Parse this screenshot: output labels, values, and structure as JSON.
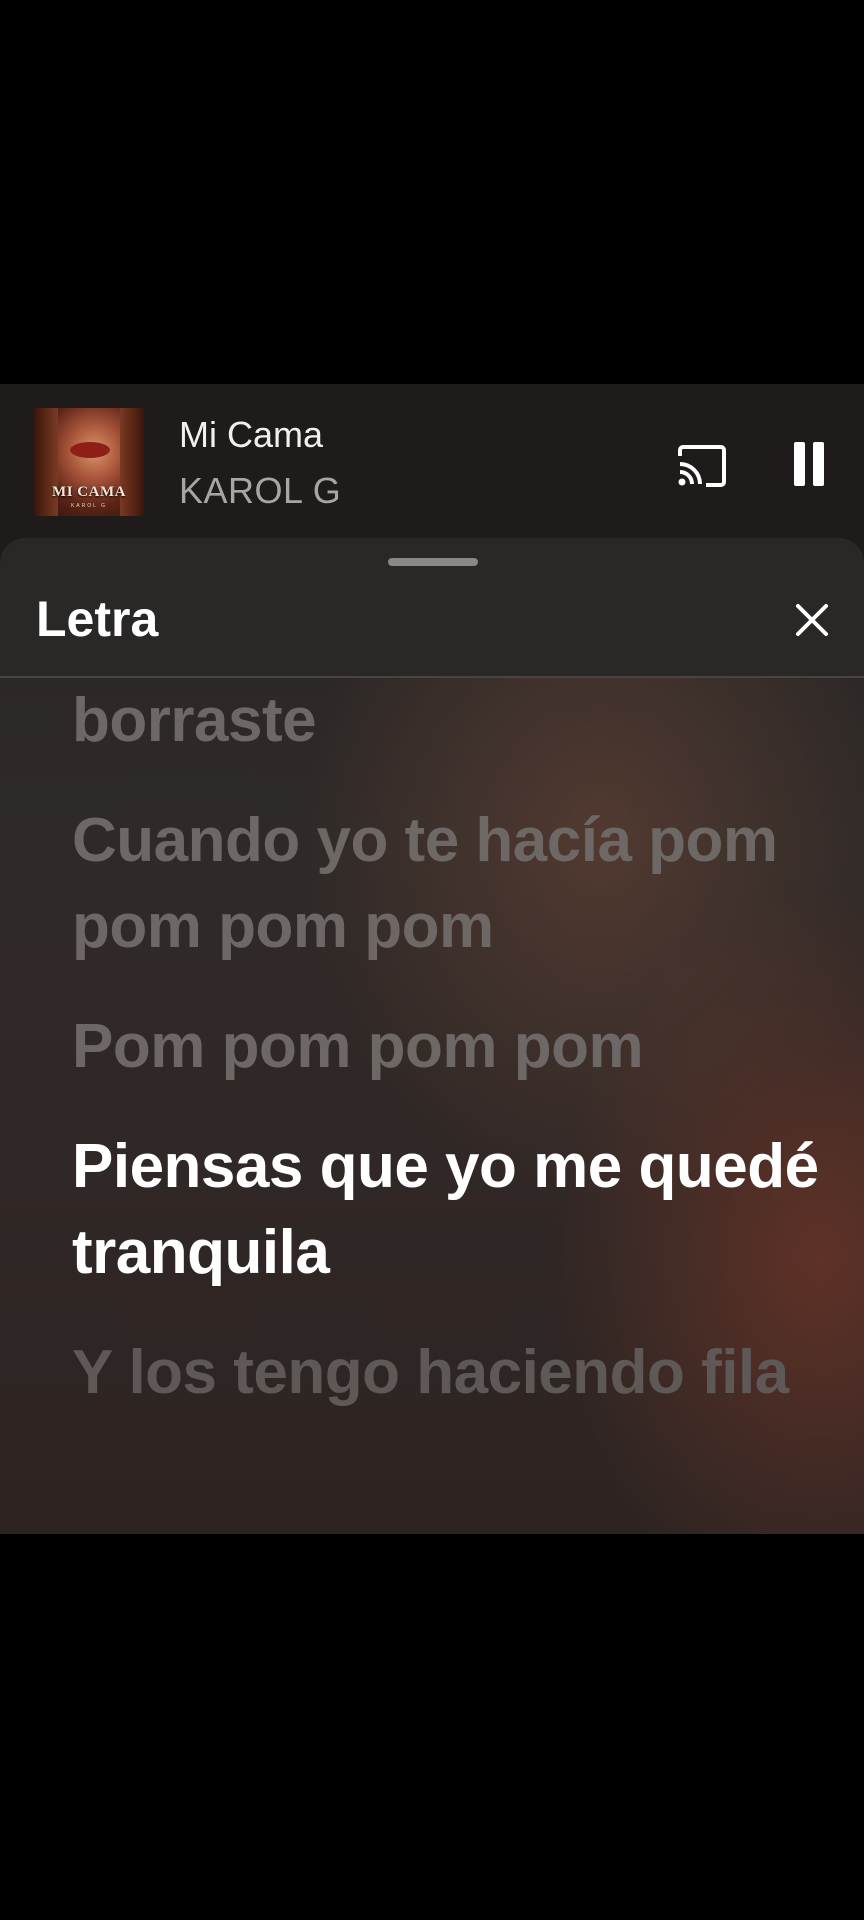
{
  "now_playing": {
    "album_art": {
      "title": "MI CAMA",
      "subtitle": "KAROL G"
    },
    "title": "Mi Cama",
    "artist": "KAROL G",
    "cast_icon": "cast-icon",
    "pause_icon": "pause-icon",
    "state": "playing"
  },
  "lyrics_sheet": {
    "title": "Letra",
    "close_icon": "close-icon",
    "lines": [
      {
        "text": "borraste",
        "state": "past"
      },
      {
        "text": "Cuando yo te hacía pom pom pom pom",
        "state": "past"
      },
      {
        "text": "Pom pom pom pom",
        "state": "past"
      },
      {
        "text": "Piensas que yo me quedé tranquila",
        "state": "current"
      },
      {
        "text": "Y los tengo haciendo fila",
        "state": "upcoming"
      }
    ]
  },
  "colors": {
    "background": "#000000",
    "player_bg": "#1f1b1a",
    "active_lyric": "#ffffff",
    "inactive_lyric": "#6d6866"
  }
}
